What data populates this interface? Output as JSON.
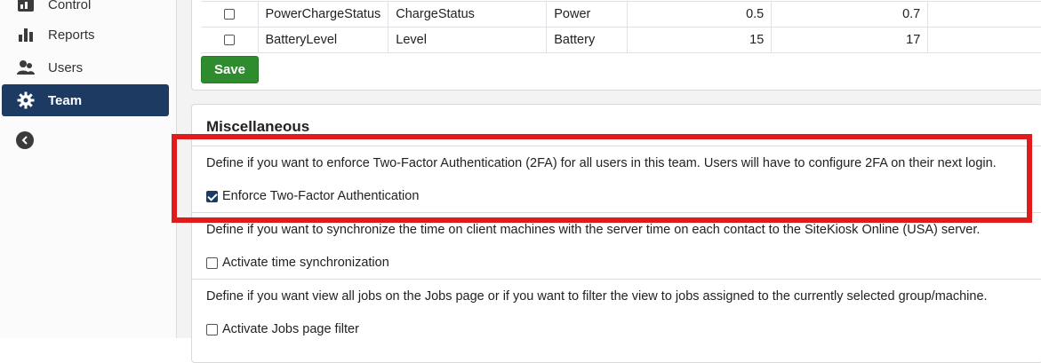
{
  "sidebar": {
    "items": [
      {
        "label": "Control",
        "icon": "dashboard-icon"
      },
      {
        "label": "Reports",
        "icon": "bar-chart-icon"
      },
      {
        "label": "Users",
        "icon": "users-icon"
      },
      {
        "label": "Team",
        "icon": "gear-icon",
        "active": true
      }
    ],
    "collapse_icon": "chevron-left-icon"
  },
  "variables_table": {
    "rows": [
      {
        "checked": false,
        "name": "PowerChargeStatus",
        "short": "ChargeStatus",
        "category": "Power",
        "min": "0.5",
        "max": "0.7"
      },
      {
        "checked": false,
        "name": "BatteryLevel",
        "short": "Level",
        "category": "Battery",
        "min": "15",
        "max": "17"
      }
    ],
    "save_label": "Save"
  },
  "misc": {
    "title": "Miscellaneous",
    "settings": [
      {
        "description": "Define if you want to enforce Two-Factor Authentication (2FA) for all users in this team. Users will have to configure 2FA on their next login.",
        "checkbox_label": "Enforce Two-Factor Authentication",
        "checked": true
      },
      {
        "description": "Define if you want to synchronize the time on client machines with the server time on each contact to the SiteKiosk Online (USA) server.",
        "checkbox_label": "Activate time synchronization",
        "checked": false
      },
      {
        "description": "Define if you want view all jobs on the Jobs page or if you want to filter the view to jobs assigned to the currently selected group/machine.",
        "checkbox_label": "Activate Jobs page filter",
        "checked": false
      }
    ]
  },
  "colors": {
    "accent": "#1d3a63",
    "save_button": "#2e8b2e",
    "highlight_border": "#e01b1b"
  }
}
